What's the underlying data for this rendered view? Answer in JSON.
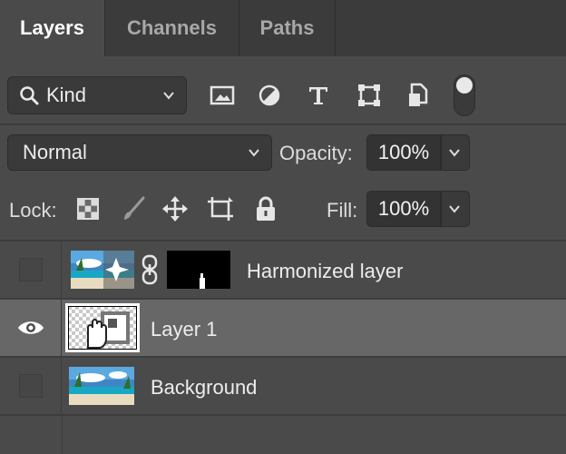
{
  "tabs": [
    {
      "label": "Layers",
      "active": true
    },
    {
      "label": "Channels",
      "active": false
    },
    {
      "label": "Paths",
      "active": false
    }
  ],
  "filter": {
    "kind_label": "Kind",
    "icons": [
      "image-filter-icon",
      "adjustment-filter-icon",
      "type-filter-icon",
      "shape-filter-icon",
      "smart-object-filter-icon"
    ],
    "toggle_on": true
  },
  "blend": {
    "mode": "Normal",
    "opacity_label": "Opacity:",
    "opacity_value": "100%"
  },
  "lock": {
    "label": "Lock:",
    "icons": [
      "lock-transparent-pixels-icon",
      "lock-image-pixels-icon",
      "lock-position-icon",
      "prevent-autonest-icon",
      "lock-all-icon"
    ],
    "fill_label": "Fill:",
    "fill_value": "100%"
  },
  "layers": [
    {
      "name": "Harmonized layer",
      "visible": false,
      "selected": false,
      "linked_mask": true
    },
    {
      "name": "Layer 1",
      "visible": true,
      "selected": true,
      "linked_mask": false
    },
    {
      "name": "Background",
      "visible": false,
      "selected": false,
      "linked_mask": false
    }
  ],
  "colors": {
    "panel_bg": "#4a4a4a",
    "tabbar_bg": "#3b3b3b",
    "selected_row": "#676767",
    "text": "#e6e6e6"
  }
}
